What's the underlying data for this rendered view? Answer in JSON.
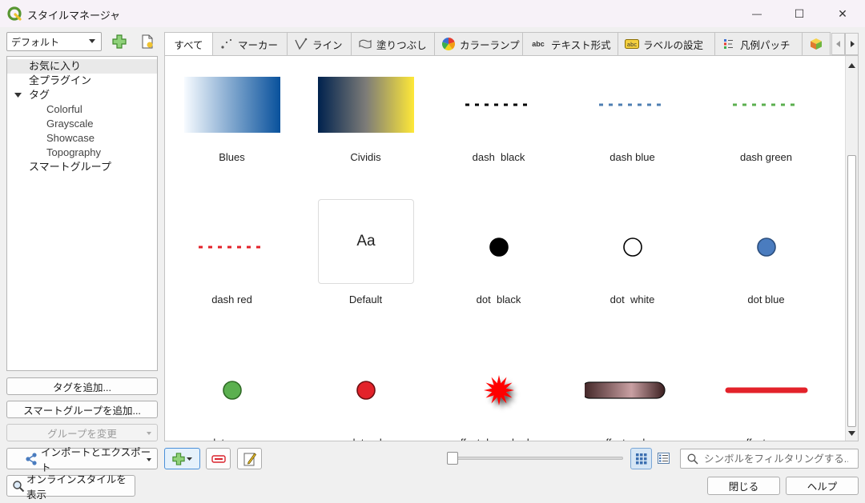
{
  "window": {
    "title": "スタイルマネージャ",
    "min_glyph": "—",
    "max_glyph": "☐",
    "close_glyph": "✕"
  },
  "left": {
    "library_combo": "デフォルト",
    "tree": [
      {
        "label": "お気に入り",
        "level": 0,
        "selected": true
      },
      {
        "label": "全プラグイン",
        "level": 0
      },
      {
        "label": "タグ",
        "level": 0,
        "expanded": true
      },
      {
        "label": "Colorful",
        "level": 1
      },
      {
        "label": "Grayscale",
        "level": 1
      },
      {
        "label": "Showcase",
        "level": 1
      },
      {
        "label": "Topography",
        "level": 1
      },
      {
        "label": "スマートグループ",
        "level": 0
      }
    ],
    "add_tag_button": "タグを追加...",
    "add_smartgroup_button": "スマートグループを追加...",
    "modify_group_button": "グループを変更",
    "import_export_button": "インポートとエクスポート",
    "online_styles_button": "オンラインスタイルを表示"
  },
  "tabs": [
    {
      "label": "すべて",
      "icon": "none"
    },
    {
      "label": "マーカー",
      "icon": "marker-icon"
    },
    {
      "label": "ライン",
      "icon": "line-icon"
    },
    {
      "label": "塗りつぶし",
      "icon": "fill-icon"
    },
    {
      "label": "カラーランプ",
      "icon": "color-ramp-icon"
    },
    {
      "label": "テキスト形式",
      "icon": "text-format-icon"
    },
    {
      "label": "ラベルの設定",
      "icon": "label-settings-icon"
    },
    {
      "label": "凡例パッチ",
      "icon": "legend-patch-icon"
    }
  ],
  "symbols": [
    {
      "label": "Blues",
      "kind": "gradient",
      "colors": [
        "#f7fbff",
        "#08519c"
      ]
    },
    {
      "label": "Cividis",
      "kind": "gradient",
      "colors": [
        "#00224e",
        "#7d7c78",
        "#fee838"
      ]
    },
    {
      "label": "dash  black",
      "kind": "dash",
      "color": "#000000"
    },
    {
      "label": "dash blue",
      "kind": "dash",
      "color": "#4f7fb2"
    },
    {
      "label": "dash green",
      "kind": "dash",
      "color": "#5bb04f"
    },
    {
      "label": "dash red",
      "kind": "dash",
      "color": "#e3222a"
    },
    {
      "label": "Default",
      "kind": "text",
      "text": "Aa"
    },
    {
      "label": "dot  black",
      "kind": "dot",
      "fill": "#000000",
      "stroke": "#000000"
    },
    {
      "label": "dot  white",
      "kind": "dot",
      "fill": "#ffffff",
      "stroke": "#000000"
    },
    {
      "label": "dot blue",
      "kind": "dot",
      "fill": "#4a7cbf",
      "stroke": "#2b4e7d"
    },
    {
      "label": "dot green",
      "kind": "dot",
      "fill": "#5bb04f",
      "stroke": "#2f6a25"
    },
    {
      "label": "dot red",
      "kind": "dot",
      "fill": "#e3222a",
      "stroke": "#6e0f12"
    },
    {
      "label": "effect drop shadow",
      "kind": "star",
      "fill": "#ff0000"
    },
    {
      "label": "effect emboss",
      "kind": "emboss",
      "colors": [
        "#3b1f20",
        "#c9a0a3"
      ]
    },
    {
      "label": "effect neon",
      "kind": "neon",
      "color": "#e3222a"
    }
  ],
  "search": {
    "placeholder": "シンボルをフィルタリングする..."
  },
  "footer": {
    "close_button": "閉じる",
    "help_button": "ヘルプ"
  }
}
